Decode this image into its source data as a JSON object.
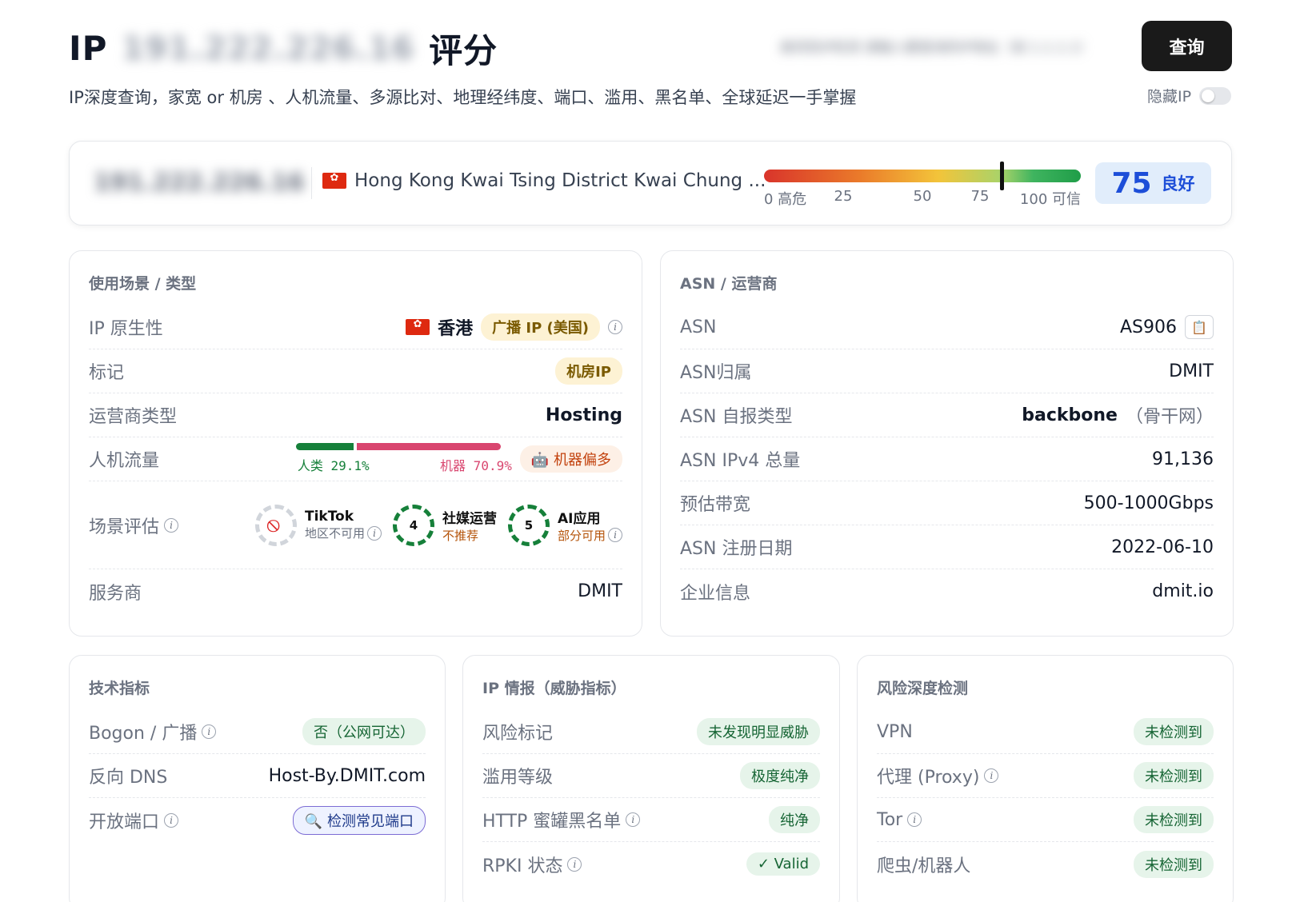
{
  "header": {
    "title_prefix": "IP",
    "title_ip": "191.222.226.16",
    "title_suffix": "评分",
    "subtitle": "IP深度查询，家宽 or 机房 、人机流量、多源比对、地理经纬度、端口、滥用、黑名单、全球延迟一手掌握",
    "search_value": "高风险IP检测 请输入要查询的IP地址（如 1.1.1.1）",
    "search_button": "查询",
    "hide_ip_label": "隐藏IP",
    "hide_ip_enabled": false
  },
  "score": {
    "ip": "191.222.226.16",
    "location": "Hong Kong Kwai Tsing District Kwai Chung ...",
    "ticks": [
      "0 高危",
      "25",
      "50",
      "75",
      "100 可信"
    ],
    "value": 75,
    "value_label": "75",
    "grade": "良好"
  },
  "usage": {
    "title": "使用场景 / 类型",
    "native": {
      "label": "IP 原生性",
      "region": "香港",
      "badge": "广播 IP (美国)"
    },
    "tag": {
      "label": "标记",
      "badge": "机房IP"
    },
    "carrier_type": {
      "label": "运营商类型",
      "value": "Hosting"
    },
    "traffic": {
      "label": "人机流量",
      "human_label": "人类  29.1%",
      "machine_label": "机器  70.9%",
      "human_pct": 29.1,
      "machine_pct": 70.9,
      "badge": "🤖 机器偏多"
    },
    "scenes": {
      "label": "场景评估",
      "items": [
        {
          "name": "TikTok",
          "status": "地区不可用",
          "score": "⃠",
          "status_color": "#6b7280"
        },
        {
          "name": "社媒运营",
          "status": "不推荐",
          "score": "4",
          "status_color": "#b45309"
        },
        {
          "name": "AI应用",
          "status": "部分可用",
          "score": "5",
          "status_color": "#b45309"
        }
      ]
    },
    "provider": {
      "label": "服务商",
      "value": "DMIT"
    }
  },
  "asn": {
    "title": "ASN / 运营商",
    "rows": [
      {
        "label": "ASN",
        "value": "AS906"
      },
      {
        "label": "ASN归属",
        "value": "DMIT"
      },
      {
        "label": "ASN 自报类型",
        "value": "backbone",
        "note": "（骨干网）"
      },
      {
        "label": "ASN IPv4 总量",
        "value": "91,136"
      },
      {
        "label": "预估带宽",
        "value": "500-1000Gbps"
      },
      {
        "label": "ASN 注册日期",
        "value": "2022-06-10"
      },
      {
        "label": "企业信息",
        "value": "dmit.io"
      }
    ]
  },
  "tech": {
    "title": "技术指标",
    "bogon_label": "Bogon / 广播",
    "bogon_value": "否（公网可达）",
    "rdns_label": "反向 DNS",
    "rdns_value": "Host-By.DMIT.com",
    "ports_label": "开放端口",
    "ports_button": "🔍 检测常见端口"
  },
  "intel": {
    "title": "IP 情报（威胁指标）",
    "rows": [
      {
        "label": "风险标记",
        "value": "未发现明显威胁"
      },
      {
        "label": "滥用等级",
        "value": "极度纯净"
      },
      {
        "label": "HTTP 蜜罐黑名单",
        "value": "纯净"
      },
      {
        "label": "RPKI 状态",
        "value": "✓ Valid"
      }
    ]
  },
  "risk": {
    "title": "风险深度检测",
    "rows": [
      {
        "label": "VPN",
        "value": "未检测到"
      },
      {
        "label": "代理 (Proxy)",
        "value": "未检测到"
      },
      {
        "label": "Tor",
        "value": "未检测到"
      },
      {
        "label": "爬虫/机器人",
        "value": "未检测到"
      }
    ]
  },
  "icons": {
    "info": "info-icon",
    "copy": "clipboard-icon",
    "flag": "hong-kong-flag-icon",
    "robot": "robot-icon",
    "search": "search-icon"
  }
}
